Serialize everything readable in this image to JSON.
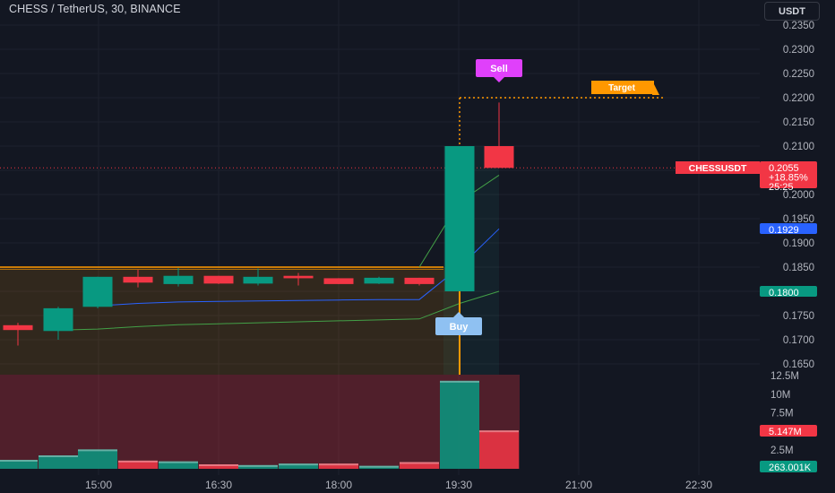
{
  "header": {
    "title": "CHESS / TetherUS, 30, BINANCE",
    "currency_button": "USDT"
  },
  "colors": {
    "up": "#089981",
    "down": "#f23645",
    "bg": "#131722",
    "grid": "#1e222d",
    "orange": "#ff9800",
    "pink": "#e040fb",
    "sky": "#8fc1f2",
    "blue_line": "#2962ff",
    "green_line": "#43a047"
  },
  "chart_data": {
    "type": "candlestick",
    "symbol": "CHESSUSDT",
    "interval": "30",
    "exchange": "BINANCE",
    "time_axis": {
      "ticks": [
        "15:00",
        "16:30",
        "18:00",
        "19:30",
        "21:00",
        "22:30"
      ]
    },
    "price_axis": {
      "ticks": [
        "0.2350",
        "0.2300",
        "0.2250",
        "0.2200",
        "0.2150",
        "0.2100",
        "0.2050",
        "0.2000",
        "0.1950",
        "0.1900",
        "0.1850",
        "0.1800",
        "0.1750",
        "0.1700",
        "0.1650"
      ]
    },
    "volume_axis": {
      "ticks": [
        "12.5M",
        "10M",
        "7.5M",
        "5M",
        "2.5M"
      ]
    },
    "candles": [
      {
        "time": "14:30",
        "open": 0.173,
        "high": 0.1735,
        "low": 0.1688,
        "close": 0.172
      },
      {
        "time": "14:30",
        "open": 0.1718,
        "high": 0.1768,
        "low": 0.17,
        "close": 0.1765
      },
      {
        "time": "15:00",
        "open": 0.1768,
        "high": 0.183,
        "low": 0.1765,
        "close": 0.183
      },
      {
        "time": "15:30",
        "open": 0.183,
        "high": 0.1845,
        "low": 0.1808,
        "close": 0.1818
      },
      {
        "time": "16:00",
        "open": 0.1815,
        "high": 0.1848,
        "low": 0.181,
        "close": 0.1832
      },
      {
        "time": "16:30",
        "open": 0.1832,
        "high": 0.1832,
        "low": 0.1815,
        "close": 0.1816
      },
      {
        "time": "17:00",
        "open": 0.1816,
        "high": 0.1847,
        "low": 0.1812,
        "close": 0.183
      },
      {
        "time": "17:30",
        "open": 0.1832,
        "high": 0.1838,
        "low": 0.1812,
        "close": 0.1827
      },
      {
        "time": "18:00",
        "open": 0.1827,
        "high": 0.1827,
        "low": 0.1815,
        "close": 0.1815
      },
      {
        "time": "18:30",
        "open": 0.1816,
        "high": 0.183,
        "low": 0.1815,
        "close": 0.1828
      },
      {
        "time": "19:00",
        "open": 0.1828,
        "high": 0.1828,
        "low": 0.1812,
        "close": 0.1815
      },
      {
        "time": "19:30",
        "open": 0.18,
        "high": 0.21,
        "low": 0.18,
        "close": 0.21
      },
      {
        "time": "20:00",
        "open": 0.21,
        "high": 0.219,
        "low": 0.2055,
        "close": 0.2055
      }
    ],
    "volume": [
      {
        "value": 1.2,
        "dir": "up"
      },
      {
        "value": 1.8,
        "dir": "up"
      },
      {
        "value": 2.6,
        "dir": "up"
      },
      {
        "value": 1.1,
        "dir": "down"
      },
      {
        "value": 1.0,
        "dir": "up"
      },
      {
        "value": 0.6,
        "dir": "down"
      },
      {
        "value": 0.5,
        "dir": "up"
      },
      {
        "value": 0.7,
        "dir": "up"
      },
      {
        "value": 0.7,
        "dir": "down"
      },
      {
        "value": 0.4,
        "dir": "up"
      },
      {
        "value": 0.9,
        "dir": "down"
      },
      {
        "value": 11.8,
        "dir": "up"
      },
      {
        "value": 5.147,
        "dir": "down"
      }
    ],
    "indicator_lines": {
      "orange": [
        0.185,
        0.185,
        0.185,
        0.185,
        0.185,
        0.185,
        0.185,
        0.185,
        0.185,
        0.185,
        0.185,
        0.185
      ],
      "blue": [
        null,
        null,
        0.177,
        0.1775,
        0.1778,
        0.1779,
        0.178,
        0.1781,
        0.1782,
        0.1783,
        0.1783,
        0.185,
        0.1929
      ],
      "green": [
        null,
        0.172,
        0.1722,
        0.1727,
        0.1731,
        0.1733,
        0.1735,
        0.1737,
        0.1739,
        0.1741,
        0.1743,
        0.1775,
        0.18
      ],
      "green_upper": [
        null,
        null,
        null,
        null,
        null,
        null,
        null,
        null,
        null,
        null,
        0.185,
        0.1985,
        0.204
      ]
    },
    "last_price_label": {
      "symbol": "CHESSUSDT",
      "price": "0.2055",
      "change": "+18.85%",
      "countdown": "25:25"
    },
    "axis_labels": {
      "blue": "0.1929",
      "green": "0.1800",
      "volume_sell": "5.147M",
      "volume_total": "263.001K"
    },
    "markers": {
      "sell": "Sell",
      "buy": "Buy",
      "target": "Target"
    }
  }
}
